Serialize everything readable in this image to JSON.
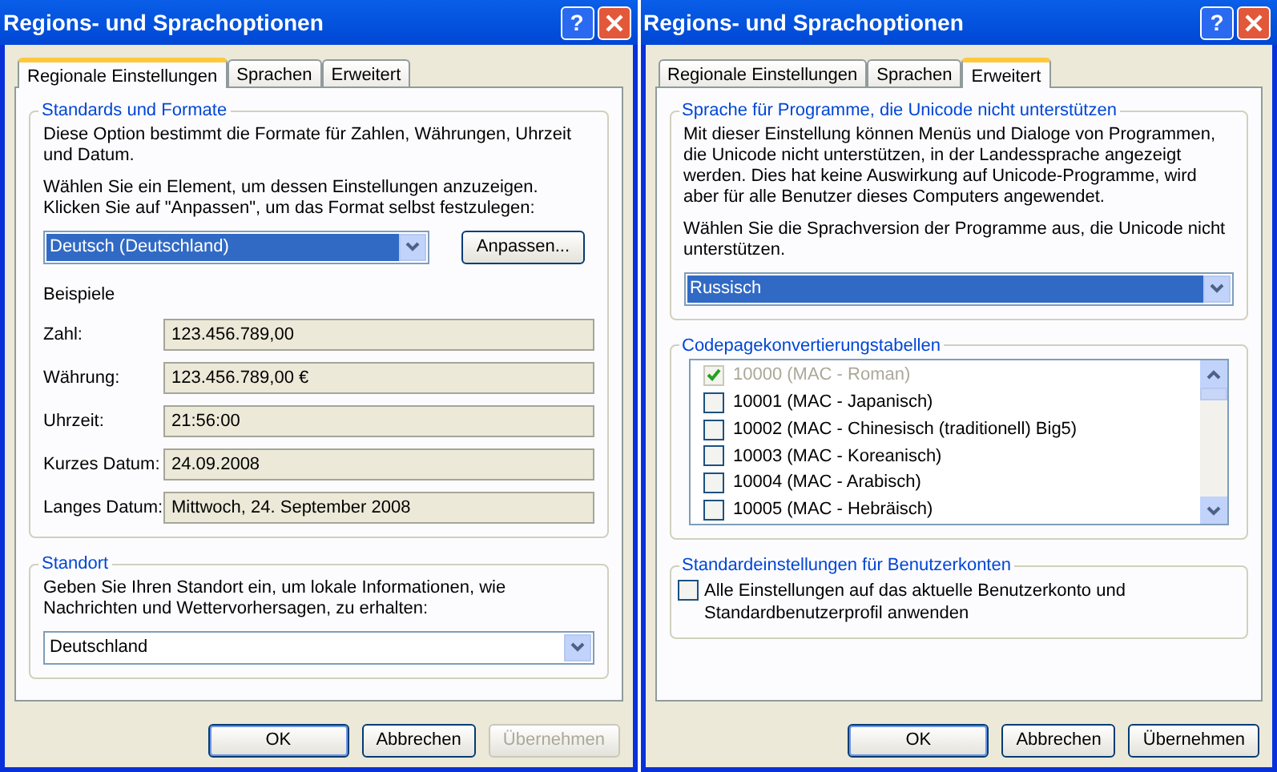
{
  "dialogs": [
    {
      "title": "Regions- und Sprachoptionen",
      "help_button": "?",
      "tabs": [
        {
          "label": "Regionale Einstellungen",
          "selected": true
        },
        {
          "label": "Sprachen",
          "selected": false
        },
        {
          "label": "Erweitert",
          "selected": false
        }
      ],
      "groups": [
        {
          "legend": "Standards und Formate",
          "items": [
            {
              "kind": "text",
              "text": "Diese Option bestimmt die Formate für Zahlen, Währungen, Uhrzeit und Datum."
            },
            {
              "kind": "text",
              "text": "Wählen Sie ein Element, um dessen Einstellungen anzuzeigen. Klicken Sie auf \"Anpassen\", um das Format selbst festzulegen:"
            },
            {
              "kind": "combo",
              "value": "Deutsch (Deutschland)",
              "focused": true,
              "button": "Anpassen..."
            },
            {
              "kind": "heading",
              "text": "Beispiele"
            },
            {
              "kind": "field",
              "label": "Zahl:",
              "value": "123.456.789,00"
            },
            {
              "kind": "field",
              "label": "Währung:",
              "value": "123.456.789,00 €"
            },
            {
              "kind": "field",
              "label": "Uhrzeit:",
              "value": "21:56:00"
            },
            {
              "kind": "field",
              "label": "Kurzes Datum:",
              "value": "24.09.2008"
            },
            {
              "kind": "field",
              "label": "Langes Datum:",
              "value": "Mittwoch, 24. September 2008"
            }
          ]
        },
        {
          "legend": "Standort",
          "items": [
            {
              "kind": "text",
              "text": "Geben Sie Ihren Standort ein, um lokale Informationen, wie Nachrichten und Wettervorhersagen, zu erhalten:"
            },
            {
              "kind": "combo",
              "value": "Deutschland",
              "focused": false
            }
          ]
        }
      ],
      "buttons": [
        {
          "label": "OK",
          "disabled": false,
          "default": true
        },
        {
          "label": "Abbrechen",
          "disabled": false,
          "default": false
        },
        {
          "label": "Übernehmen",
          "disabled": true,
          "default": false
        }
      ]
    },
    {
      "title": "Regions- und Sprachoptionen",
      "help_button": "?",
      "tabs": [
        {
          "label": "Regionale Einstellungen",
          "selected": false
        },
        {
          "label": "Sprachen",
          "selected": false
        },
        {
          "label": "Erweitert",
          "selected": true
        }
      ],
      "groups": [
        {
          "legend": "Sprache für Programme, die Unicode nicht unterstützen",
          "items": [
            {
              "kind": "text",
              "text": "Mit dieser Einstellung können Menüs und Dialoge von Programmen, die Unicode nicht unterstützen, in der Landessprache angezeigt werden. Dies hat keine Auswirkung auf Unicode-Programme, wird aber für alle Benutzer dieses Computers angewendet."
            },
            {
              "kind": "text",
              "text": "Wählen Sie die Sprachversion der Programme aus, die Unicode nicht unterstützen."
            },
            {
              "kind": "combo",
              "value": "Russisch",
              "focused": true
            }
          ]
        },
        {
          "legend": "Codepagekonvertierungstabellen",
          "items": [
            {
              "kind": "listbox",
              "rows": [
                {
                  "label": "10000 (MAC - Roman)",
                  "checked": true,
                  "disabled": true
                },
                {
                  "label": "10001 (MAC - Japanisch)",
                  "checked": false,
                  "disabled": false
                },
                {
                  "label": "10002 (MAC - Chinesisch (traditionell) Big5)",
                  "checked": false,
                  "disabled": false
                },
                {
                  "label": "10003 (MAC - Koreanisch)",
                  "checked": false,
                  "disabled": false
                },
                {
                  "label": "10004 (MAC - Arabisch)",
                  "checked": false,
                  "disabled": false
                },
                {
                  "label": "10005 (MAC - Hebräisch)",
                  "checked": false,
                  "disabled": false
                }
              ]
            }
          ]
        },
        {
          "legend": "Standardeinstellungen für Benutzerkonten",
          "items": [
            {
              "kind": "checkbox",
              "label": "Alle Einstellungen auf das aktuelle Benutzerkonto und Standardbenutzerprofil anwenden",
              "checked": false
            }
          ]
        }
      ],
      "buttons": [
        {
          "label": "OK",
          "disabled": false,
          "default": true
        },
        {
          "label": "Abbrechen",
          "disabled": false,
          "default": false
        },
        {
          "label": "Übernehmen",
          "disabled": false,
          "default": false
        }
      ]
    }
  ]
}
